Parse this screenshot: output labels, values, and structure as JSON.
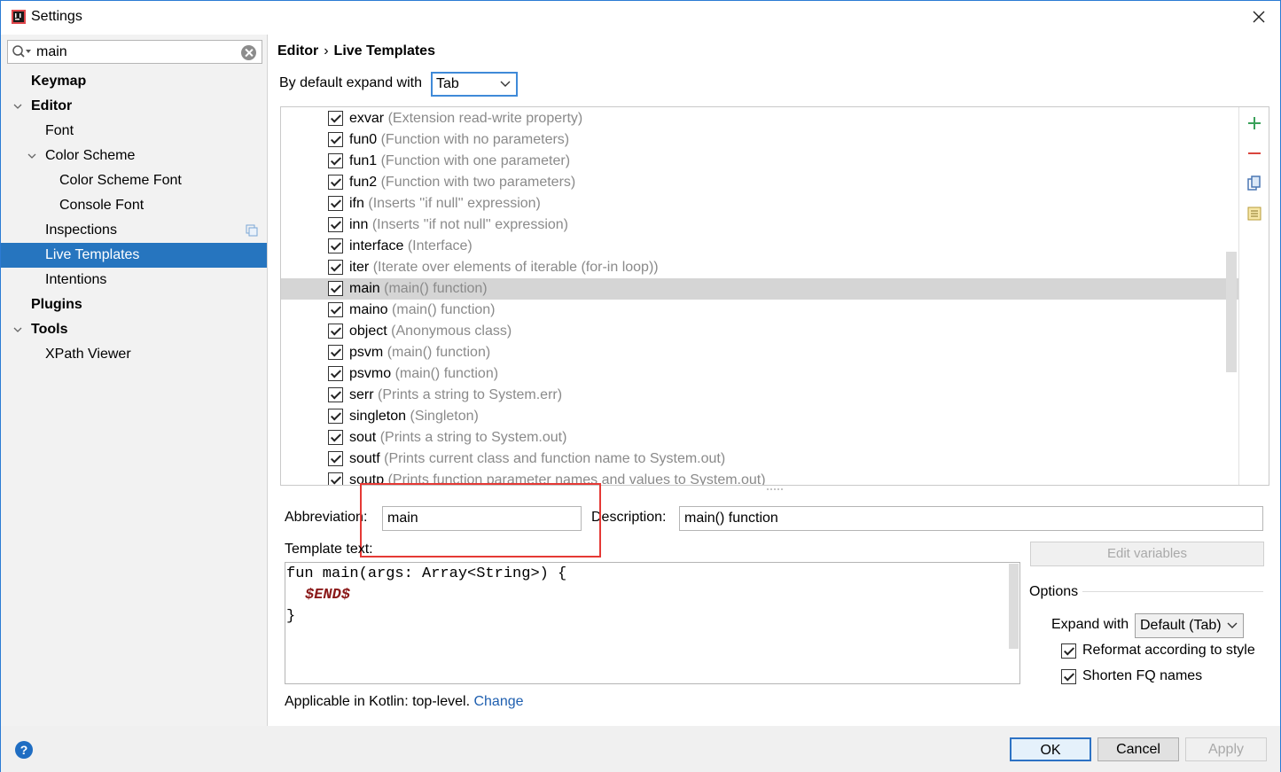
{
  "window": {
    "title": "Settings"
  },
  "search": {
    "value": "main"
  },
  "sidebar": {
    "items": [
      {
        "label": "Keymap"
      },
      {
        "label": "Editor"
      },
      {
        "label": "Font"
      },
      {
        "label": "Color Scheme"
      },
      {
        "label": "Color Scheme Font"
      },
      {
        "label": "Console Font"
      },
      {
        "label": "Inspections"
      },
      {
        "label": "Live Templates"
      },
      {
        "label": "Intentions"
      },
      {
        "label": "Plugins"
      },
      {
        "label": "Tools"
      },
      {
        "label": "XPath Viewer"
      }
    ]
  },
  "breadcrumb": {
    "parent": "Editor",
    "separator": "›",
    "current": "Live Templates"
  },
  "expand_default": {
    "label": "By default expand with",
    "value": "Tab"
  },
  "templates": [
    {
      "name": "exvar",
      "desc": "(Extension read-write property)"
    },
    {
      "name": "fun0",
      "desc": "(Function with no parameters)"
    },
    {
      "name": "fun1",
      "desc": "(Function with one parameter)"
    },
    {
      "name": "fun2",
      "desc": "(Function with two parameters)"
    },
    {
      "name": "ifn",
      "desc": "(Inserts ''if null'' expression)"
    },
    {
      "name": "inn",
      "desc": "(Inserts ''if not null'' expression)"
    },
    {
      "name": "interface",
      "desc": "(Interface)"
    },
    {
      "name": "iter",
      "desc": "(Iterate over elements of iterable (for-in loop))"
    },
    {
      "name": "main",
      "desc": "(main() function)"
    },
    {
      "name": "maino",
      "desc": "(main() function)"
    },
    {
      "name": "object",
      "desc": "(Anonymous class)"
    },
    {
      "name": "psvm",
      "desc": "(main() function)"
    },
    {
      "name": "psvmo",
      "desc": "(main() function)"
    },
    {
      "name": "serr",
      "desc": "(Prints a string to System.err)"
    },
    {
      "name": "singleton",
      "desc": "(Singleton)"
    },
    {
      "name": "sout",
      "desc": "(Prints a string to System.out)"
    },
    {
      "name": "soutf",
      "desc": "(Prints current class and function name to System.out)"
    },
    {
      "name": "soutp",
      "desc": "(Prints function parameter names and values to System.out)"
    }
  ],
  "selected_template": "main",
  "editor": {
    "abbreviation_label": "Abbreviation:",
    "abbreviation": "main",
    "description_label": "Description:",
    "description": "main() function",
    "template_text_label": "Template text:",
    "template_line1": "fun main(args: Array<String>) {",
    "template_var": "$END$",
    "template_line3": "}",
    "edit_variables": "Edit variables",
    "options_label": "Options",
    "expand_with_label": "Expand with",
    "expand_with_value": "Default (Tab)",
    "reformat_label": "Reformat according to style",
    "shorten_label": "Shorten FQ names",
    "applicable_text": "Applicable in Kotlin: top-level.",
    "change_link": "Change"
  },
  "buttons": {
    "ok": "OK",
    "cancel": "Cancel",
    "apply": "Apply",
    "help": "?"
  },
  "colors": {
    "accent": "#2675bf",
    "highlight_box": "#e53935",
    "template_variable": "#8b1a1a"
  }
}
